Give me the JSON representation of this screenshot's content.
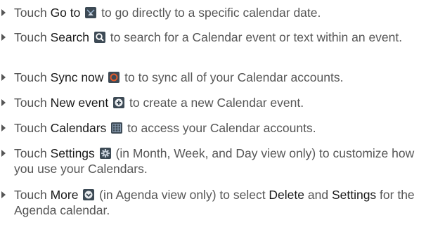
{
  "items": [
    {
      "pre": "Touch ",
      "keyword": "Go to",
      "icon": "go-to-date-icon",
      "post": " to go directly to a specific calendar date."
    },
    {
      "pre": "Touch ",
      "keyword": "Search",
      "icon": "search-icon",
      "post": " to search for a Calendar event or text within an event."
    },
    {
      "pre": "Touch ",
      "keyword": "Sync now",
      "icon": "sync-icon",
      "post": " to to sync all of your Calendar accounts."
    },
    {
      "pre": "Touch ",
      "keyword": "New event",
      "icon": "add-event-icon",
      "post": " to create a new Calendar event."
    },
    {
      "pre": "Touch ",
      "keyword": "Calendars",
      "icon": "calendar-grid-icon",
      "post": " to access your Calendar accounts."
    },
    {
      "pre": "Touch ",
      "keyword": "Settings",
      "icon": "gear-icon",
      "post": " (in Month, Week, and Day view only) to customize how you use your Calendars."
    },
    {
      "pre": "Touch ",
      "keyword": "More",
      "icon": "more-chevron-icon",
      "post_1": " (in Agenda view only) to select ",
      "keyword_2": "Delete",
      "post_2": " and ",
      "keyword_3": "Settings",
      "post_3": " for the Agenda calendar."
    }
  ]
}
